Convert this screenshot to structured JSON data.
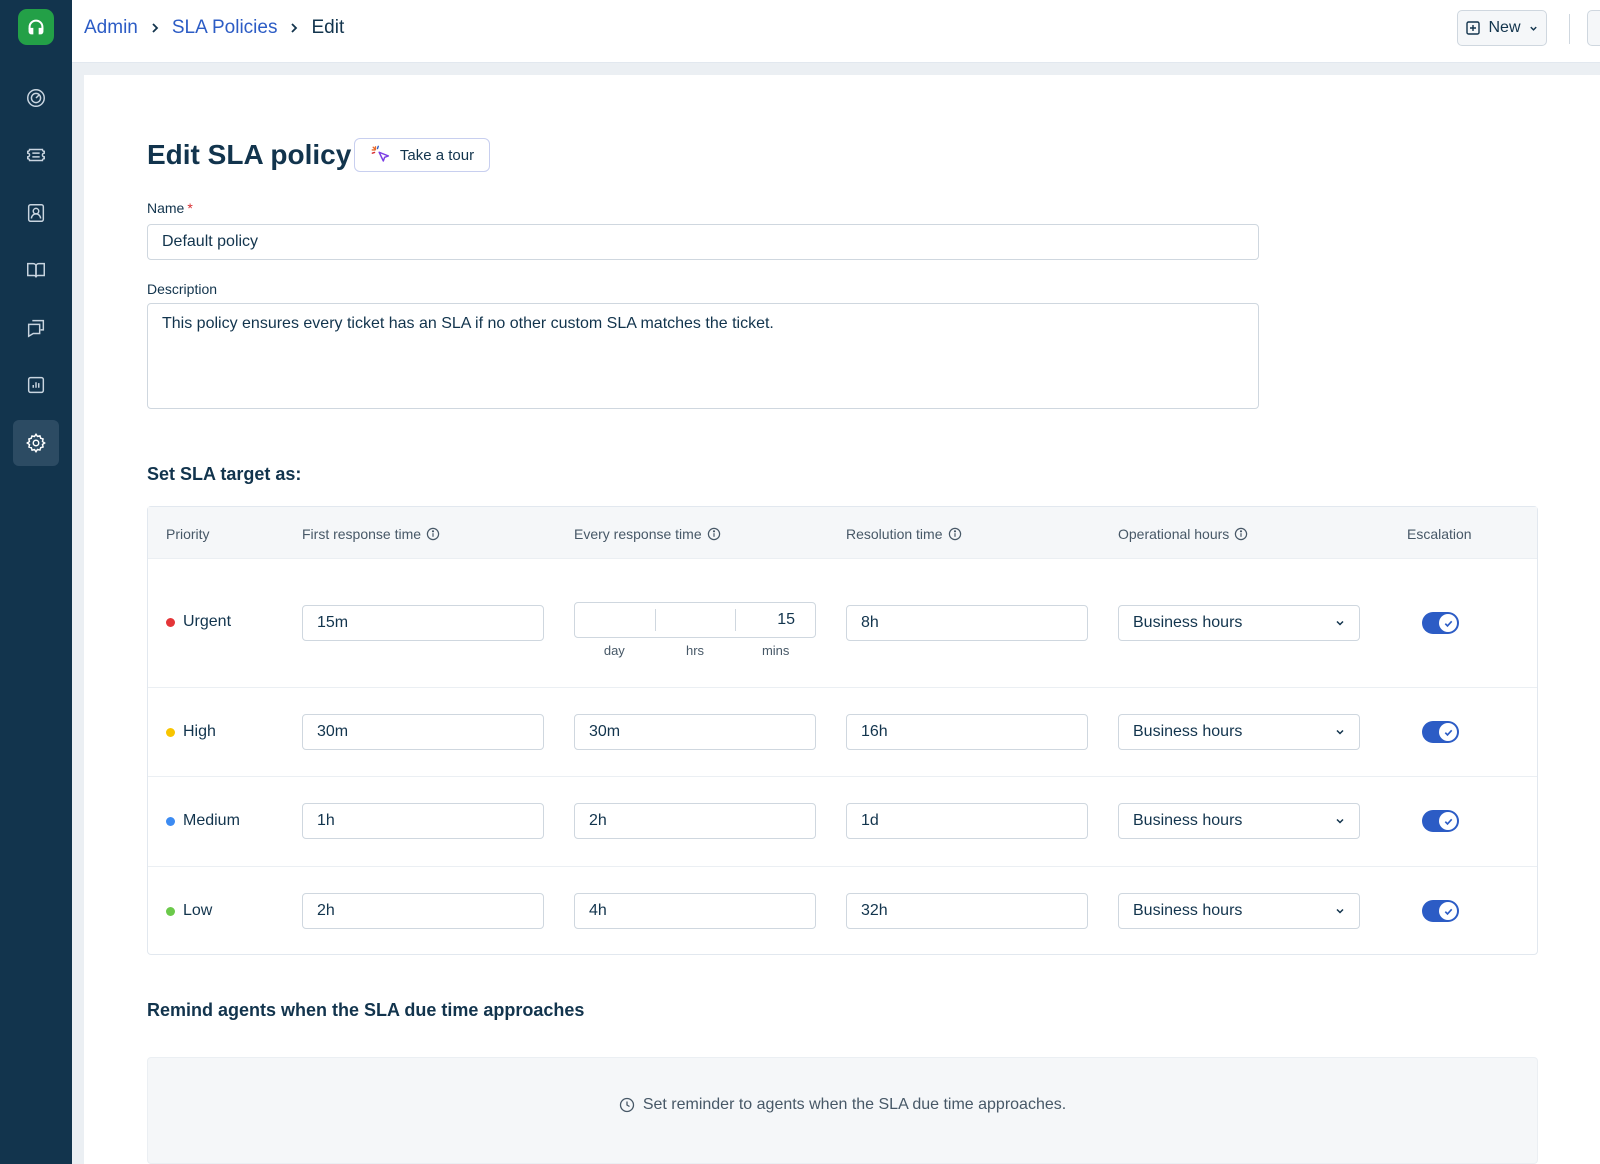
{
  "breadcrumb": {
    "admin": "Admin",
    "sla_policies": "SLA Policies",
    "current": "Edit"
  },
  "header": {
    "new_label": "New"
  },
  "page": {
    "title": "Edit SLA policy",
    "tour_label": "Take a tour"
  },
  "form": {
    "name_label": "Name",
    "name_required": "*",
    "name_value": "Default policy",
    "description_label": "Description",
    "description_value": "This policy ensures every ticket has an SLA if no other custom SLA matches the ticket."
  },
  "sla": {
    "section_title": "Set SLA target as:",
    "columns": {
      "priority": "Priority",
      "first_response": "First response time",
      "every_response": "Every response time",
      "resolution": "Resolution time",
      "operational_hours": "Operational hours",
      "escalation": "Escalation"
    },
    "split_labels": {
      "day": "day",
      "hrs": "hrs",
      "mins": "mins"
    },
    "rows": [
      {
        "priority": "Urgent",
        "dot_color": "#e43538",
        "first_response": "15m",
        "every_response": {
          "day": "",
          "hrs": "",
          "mins": "15"
        },
        "resolution": "8h",
        "operational_hours": "Business hours",
        "escalation": true
      },
      {
        "priority": "High",
        "dot_color": "#f8c500",
        "first_response": "30m",
        "every_response": "30m",
        "resolution": "16h",
        "operational_hours": "Business hours",
        "escalation": true
      },
      {
        "priority": "Medium",
        "dot_color": "#3c8bf2",
        "first_response": "1h",
        "every_response": "2h",
        "resolution": "1d",
        "operational_hours": "Business hours",
        "escalation": true
      },
      {
        "priority": "Low",
        "dot_color": "#6bc94a",
        "first_response": "2h",
        "every_response": "4h",
        "resolution": "32h",
        "operational_hours": "Business hours",
        "escalation": true
      }
    ]
  },
  "reminder": {
    "section_title": "Remind agents when the SLA due time approaches",
    "text": "Set reminder to agents when the SLA due time approaches."
  },
  "colors": {
    "sidebar_bg": "#12344d",
    "accent": "#2c5cc5",
    "logo_green": "#23a047"
  },
  "sidebar": {
    "icons": [
      "headset-logo-icon",
      "dashboard-icon",
      "tickets-icon",
      "contacts-icon",
      "knowledge-base-icon",
      "conversations-icon",
      "analytics-icon",
      "settings-icon"
    ]
  }
}
